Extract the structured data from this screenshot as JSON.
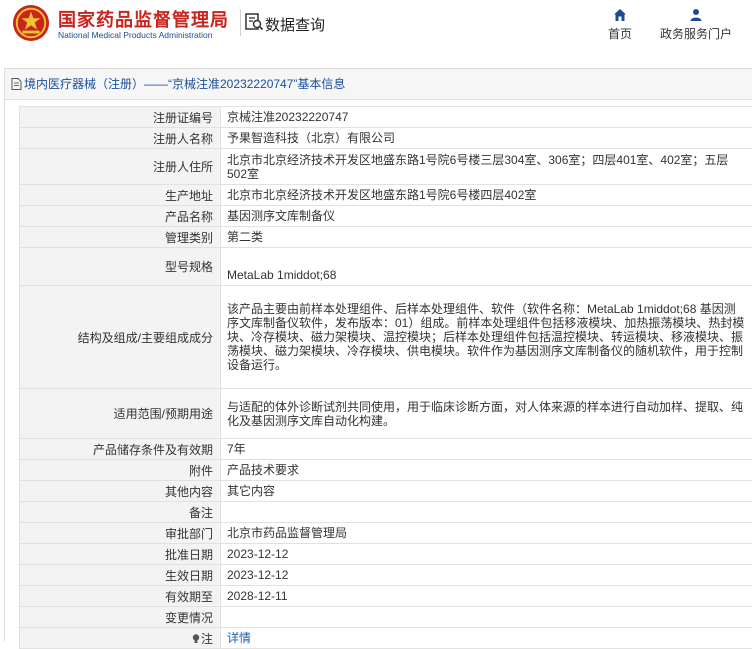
{
  "header": {
    "logo_cn": "国家药品监督管理局",
    "logo_en": "National Medical Products Administration",
    "subsystem_title": "数据查询",
    "nav": [
      {
        "label": "首页",
        "icon": "home-icon"
      },
      {
        "label": "政务服务门户",
        "icon": "user-icon"
      }
    ]
  },
  "panel": {
    "title": "境内医疗器械（注册）——“京械注准20232220747”基本信息"
  },
  "rows": [
    {
      "label": "注册证编号",
      "value": "京械注准20232220747"
    },
    {
      "label": "注册人名称",
      "value": "予果智造科技（北京）有限公司"
    },
    {
      "label": "注册人住所",
      "value": "北京市北京经济技术开发区地盛东路1号院6号楼三层304室、306室；四层401室、402室；五层502室"
    },
    {
      "label": "生产地址",
      "value": "北京市北京经济技术开发区地盛东路1号院6号楼四层402室"
    },
    {
      "label": "产品名称",
      "value": "基因测序文库制备仪"
    },
    {
      "label": "管理类别",
      "value": "第二类"
    },
    {
      "label": "型号规格",
      "value": "MetaLab 1middot;68"
    },
    {
      "label": "结构及组成/主要组成成分",
      "value": "该产品主要由前样本处理组件、后样本处理组件、软件（软件名称：MetaLab 1middot;68 基因测序文库制备仪软件，发布版本：01）组成。前样本处理组件包括移液模块、加热振荡模块、热封模块、冷存模块、磁力架模块、温控模块；后样本处理组件包括温控模块、转运模块、移液模块、振荡模块、磁力架模块、冷存模块、供电模块。软件作为基因测序文库制备仪的随机软件，用于控制设备运行。"
    },
    {
      "label": "适用范围/预期用途",
      "value": "与适配的体外诊断试剂共同使用，用于临床诊断方面，对人体来源的样本进行自动加样、提取、纯化及基因测序文库自动化构建。"
    },
    {
      "label": "产品储存条件及有效期",
      "value": "7年"
    },
    {
      "label": "附件",
      "value": "产品技术要求"
    },
    {
      "label": "其他内容",
      "value": "其它内容"
    },
    {
      "label": "备注",
      "value": ""
    },
    {
      "label": "审批部门",
      "value": "北京市药品监督管理局"
    },
    {
      "label": "批准日期",
      "value": "2023-12-12"
    },
    {
      "label": "生效日期",
      "value": "2023-12-12"
    },
    {
      "label": "有效期至",
      "value": "2028-12-11"
    },
    {
      "label": "变更情况",
      "value": ""
    },
    {
      "label": "注",
      "value": "详情"
    }
  ],
  "colors": {
    "brand_red": "#c8251e",
    "brand_blue": "#1c4b94",
    "link_blue": "#1a5fb4"
  }
}
